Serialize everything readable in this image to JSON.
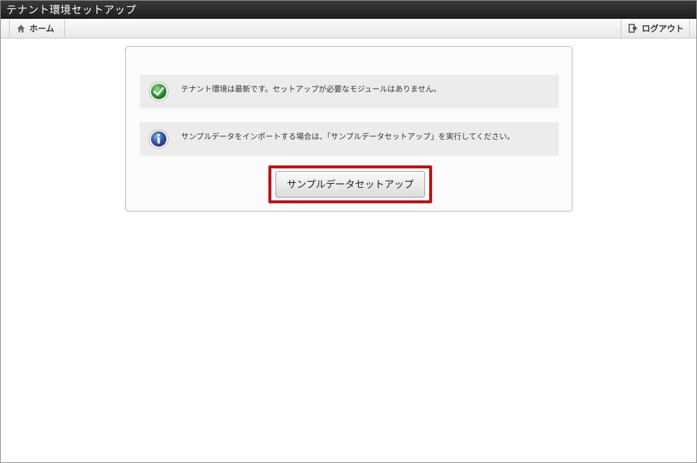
{
  "window": {
    "title": "テナント環境セットアップ"
  },
  "nav": {
    "home_label": "ホーム",
    "logout_label": "ログアウト"
  },
  "messages": [
    {
      "type": "success",
      "icon": "check-icon",
      "text": "テナント環境は最新です。セットアップが必要なモジュールはありません。"
    },
    {
      "type": "info",
      "icon": "info-icon",
      "text": "サンプルデータをインポートする場合は、「サンプルデータセットアップ」を実行してください。"
    }
  ],
  "actions": {
    "sample_setup_label": "サンプルデータセットアップ"
  },
  "colors": {
    "highlight": "#e00000",
    "success": "#2e9e2e",
    "info": "#2f55b5"
  }
}
